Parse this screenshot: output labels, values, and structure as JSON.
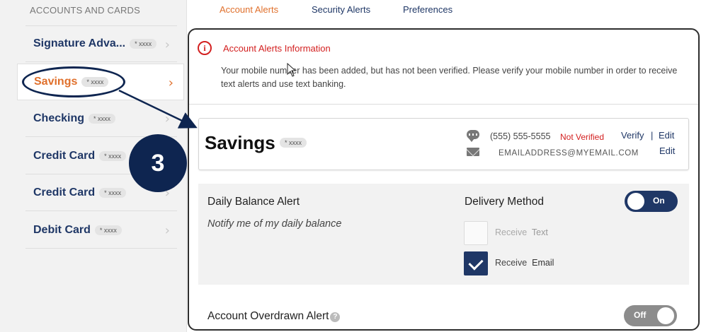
{
  "sidebar": {
    "heading": "ACCOUNTS AND CARDS",
    "items": [
      {
        "name": "Signature Adva...",
        "mask": "* xxxx",
        "active": false
      },
      {
        "name": "Savings",
        "mask": "* xxxx",
        "active": true
      },
      {
        "name": "Checking",
        "mask": "* xxxx",
        "active": false
      },
      {
        "name": "Credit Card",
        "mask": "* xxxx",
        "active": false
      },
      {
        "name": "Credit Card",
        "mask": "* xxxx",
        "active": false
      },
      {
        "name": "Debit Card",
        "mask": "* xxxx",
        "active": false
      }
    ]
  },
  "tabs": [
    {
      "label": "Account Alerts",
      "active": true
    },
    {
      "label": "Security Alerts",
      "active": false
    },
    {
      "label": "Preferences",
      "active": false
    }
  ],
  "annotation": {
    "step": "3"
  },
  "info": {
    "title": "Account Alerts Information",
    "icon": "i",
    "message": "Your mobile number has been added, but has not been verified. Please verify your mobile number in order to receive text alerts and use text banking."
  },
  "account_card": {
    "title": "Savings",
    "mask": "* xxxx",
    "phone": "(555) 555-5555",
    "phone_status": "Not Verified",
    "verify_label": "Verify",
    "separator": "|",
    "edit_label": "Edit",
    "email": "EMAILADDRESS@MYEMAIL.COM",
    "email_edit_label": "Edit"
  },
  "daily_balance_alert": {
    "title": "Daily Balance Alert",
    "description": "Notify me of my daily balance",
    "delivery_label": "Delivery Method",
    "toggle_label": "On",
    "option_text_prefix": "Receive",
    "option_text_label": "Text",
    "option_text_checked": false,
    "option_email_prefix": "Receive",
    "option_email_label": "Email",
    "option_email_checked": true
  },
  "overdrawn_alert": {
    "title": "Account Overdrawn Alert",
    "help": "?",
    "toggle_label": "Off"
  },
  "colors": {
    "accent": "#e0702c",
    "navy": "#1f3766",
    "error": "#d32020"
  }
}
